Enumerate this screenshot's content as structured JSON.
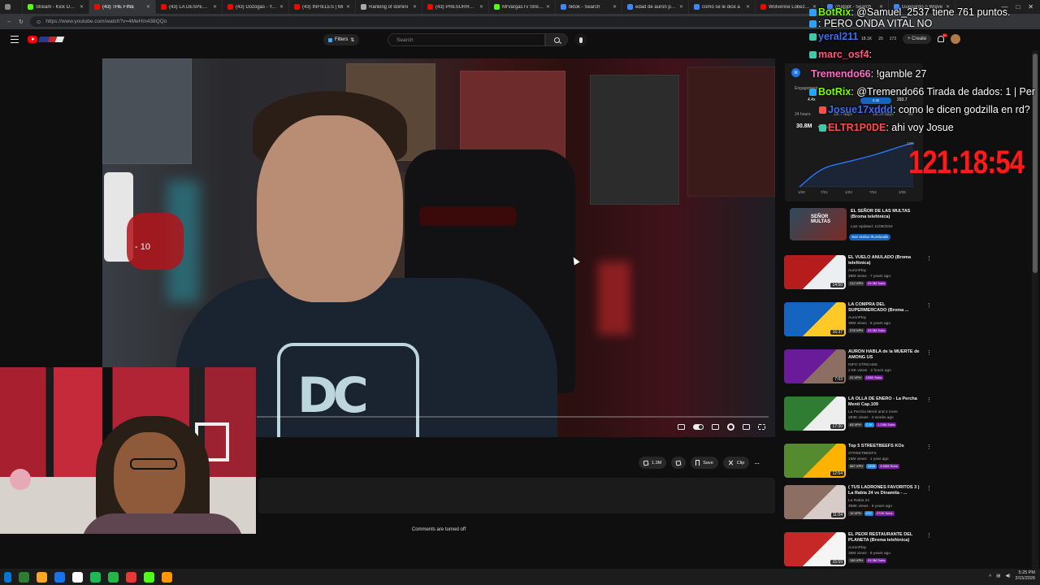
{
  "browser": {
    "tabs": [
      {
        "title": "Stream - Kick Dashb",
        "color": "#53fc18"
      },
      {
        "title": "(43) THE FINE",
        "color": "#ff0000",
        "active": true
      },
      {
        "title": "(43) LA DESPEDIDA",
        "color": "#ff0000"
      },
      {
        "title": "(43) Dozogas - You",
        "color": "#ff0000"
      },
      {
        "title": "(43) INFIELES | Mi",
        "color": "#ff0000"
      },
      {
        "title": "Ranking of domini",
        "color": "#aaaaaa"
      },
      {
        "title": "(43) PRESURRE LE",
        "color": "#ff0000"
      },
      {
        "title": "MrVargasTv Stream",
        "color": "#53fc18"
      },
      {
        "title": "tiktok - Search",
        "color": "#4285f4"
      },
      {
        "title": "edad de auron play",
        "color": "#4285f4"
      },
      {
        "title": "como se le dice a",
        "color": "#4285f4"
      },
      {
        "title": "Wolverine Lobezno",
        "color": "#ff0000"
      },
      {
        "title": "chatgpt - Search",
        "color": "#4285f4"
      },
      {
        "title": "Guepardo o Wolve",
        "color": "#4285f4"
      }
    ],
    "url": "https://www.youtube.com/watch?v=4MeHm438QQo"
  },
  "youtube": {
    "filters_label": "Filters",
    "search_placeholder": "Search",
    "header_stats": [
      "18.1K",
      "20",
      "173"
    ],
    "create_label": "Create",
    "notif_count": "9+"
  },
  "player": {
    "overlay_text": "- 10"
  },
  "actions": {
    "like_count": "1.3M",
    "save_label": "Save",
    "clip_label": "Clip"
  },
  "comments_off": "Comments are turned off",
  "analytics": {
    "label_top": "Engagement",
    "chip": "4.3x",
    "stats": [
      "4.4x",
      "293.7"
    ],
    "periods": [
      "24 hours",
      "1st 7 days",
      "1st 24 days",
      "All"
    ],
    "total_value": "30.8M",
    "total_label": "Total views",
    "y_max": "32M",
    "y_ticks": [
      "32M",
      "0"
    ],
    "x_ticks": [
      "1/19",
      "1/20",
      "7/21",
      "1/23",
      "7/24",
      "2/25"
    ]
  },
  "promo": {
    "thumb_text": "SEÑOR MULTAS",
    "title": "EL SEÑOR DE LAS MULTAS (Broma telefónica)",
    "sub": "Last Updated: 11/09/2018",
    "button": "See similar thumbnails"
  },
  "rail": [
    {
      "title": "EL VUELO ANULADO (Broma telefónica)",
      "channel": "AuronPlay",
      "meta": "39M views · 7 years ago",
      "chips": [
        "212 VPH",
        "29.3M Subs"
      ],
      "duration": "14:50",
      "thumb": [
        "#b71c1c",
        "#eceff1"
      ]
    },
    {
      "title": "LA COMPRA DEL SUPERMERCADO (Broma ...",
      "channel": "AuronPlay",
      "meta": "39M views · 6 years ago",
      "chips": [
        "276 VPH",
        "29.3M Subs"
      ],
      "duration": "16:37",
      "thumb": [
        "#1565c0",
        "#ffca28"
      ]
    },
    {
      "title": "AURON HABLA de la MUERTE de AMONG US",
      "channel": "INFO STREAMS",
      "meta": "2.5K views · 2 hours ago",
      "chips": [
        "21 VPH",
        "135K Subs"
      ],
      "duration": "7:03",
      "thumb": [
        "#6a1b9a",
        "#8d6e63"
      ]
    },
    {
      "title": "LA OLLA DE ENERO - La Percha Mentí Cap.109",
      "channel": "La Percha Mentí and 2 more",
      "meta": "283K views · 2 weeks ago",
      "chips": [
        "63 VPH",
        "2.2K",
        "1.24M Subs"
      ],
      "duration": "17:30",
      "thumb": [
        "#2e7d32",
        "#eeeeee"
      ]
    },
    {
      "title": "Top 5 STREETBEEFS KOs",
      "channel": "STREETBEEFS",
      "meta": "16M views · 1 year ago",
      "chips": [
        "587 VPH",
        "146K",
        "6.63M Subs"
      ],
      "duration": "12:54",
      "thumb": [
        "#558b2f",
        "#ffb300"
      ]
    },
    {
      "title": "( TUS LADRONES FAVORITOS 3 ) La Rabia 24 vs Dinamita - ...",
      "channel": "La Rabia 24",
      "meta": "358K views · 6 years ago",
      "chips": [
        "10 VPH",
        "27K",
        "270K Subs"
      ],
      "duration": "11:04",
      "thumb": [
        "#8d6e63",
        "#d7ccc8"
      ]
    },
    {
      "title": "EL PEOR RESTAURANTE DEL PLANETA (Broma telefónica)",
      "channel": "AuronPlay",
      "meta": "35M views · 8 years ago",
      "chips": [
        "150 VPH",
        "29.3M Subs"
      ],
      "duration": "15:59",
      "thumb": [
        "#c62828",
        "#f5f5f5"
      ]
    }
  ],
  "chat": [
    {
      "user": "BotRix",
      "text": ": @Samuel_2537 tiene 761 puntos.",
      "color": "#7cfc00",
      "badge": "#2aa3ff"
    },
    {
      "user": "",
      "text": ": PERO ONDA VITAL NO",
      "color": "#7cfc00",
      "badge": "#2aa3ff"
    },
    {
      "user": "yeral211",
      "text": "",
      "color": "#3f6ff0",
      "badge": "#3ec9a7"
    },
    {
      "user": "marc_osf4",
      "text": ":",
      "color": "#ff5a7a",
      "badge": "#3ec9a7"
    },
    {
      "user": "Tremendo66",
      "text": ": !gamble 27",
      "color": "#ff6ec7",
      "badge": ""
    },
    {
      "user": "BotRix",
      "text": ": @Tremendo66 Tirada de dados: 1 | Per",
      "color": "#7cfc00",
      "badge": "#2aa3ff"
    },
    {
      "user": "Josue17xddd",
      "text": ": como le dicen godzilla en rd?",
      "color": "#3f6ff0",
      "badge": "#ff4d4d"
    },
    {
      "user": "ELTR1P0DE",
      "text": ": ahi voy Josue",
      "color": "#ff4d4d",
      "badge": "#3ec9a7"
    }
  ],
  "timer": "121:18:54",
  "taskbar": {
    "time": "5:25 PM",
    "date": "2/15/2026",
    "icons": [
      "#0078d4",
      "#2e7d32",
      "#f9a825",
      "#1a73e8",
      "#ffffff",
      "#1db954",
      "#2bb34a",
      "#e53935",
      "#53fc18",
      "#ff9800"
    ]
  }
}
